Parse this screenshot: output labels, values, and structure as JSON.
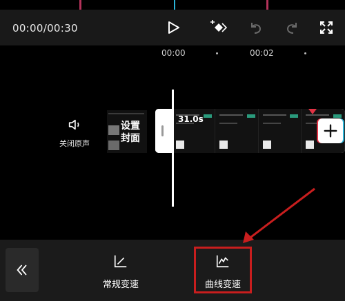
{
  "player": {
    "time": "00:00/00:30"
  },
  "ruler": {
    "ticks": [
      "00:00",
      "00:02"
    ]
  },
  "track": {
    "mute_label": "关闭原声",
    "cover_label": "设置\n封面",
    "clip_duration": "31.0s"
  },
  "bottom": {
    "options": [
      {
        "label": "常规变速"
      },
      {
        "label": "曲线变速"
      }
    ]
  },
  "colors": {
    "highlight": "#c81e1e",
    "accent_red": "#e23244",
    "accent_cyan": "#2ab4d8"
  }
}
